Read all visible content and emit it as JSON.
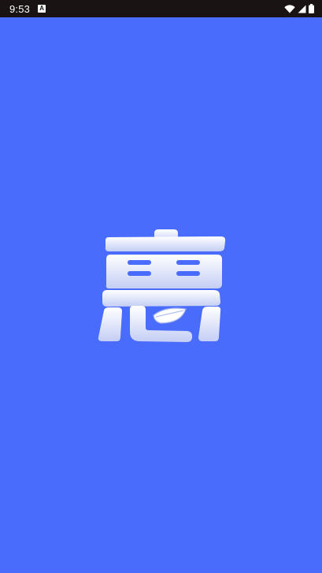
{
  "status_bar": {
    "time": "9:53",
    "notification_icon_glyph": "A",
    "icons": [
      "notification-a-icon",
      "wifi-icon",
      "cellular-icon",
      "battery-icon"
    ]
  },
  "splash": {
    "background_color": "#4a6cfc",
    "logo_text": "惠"
  }
}
